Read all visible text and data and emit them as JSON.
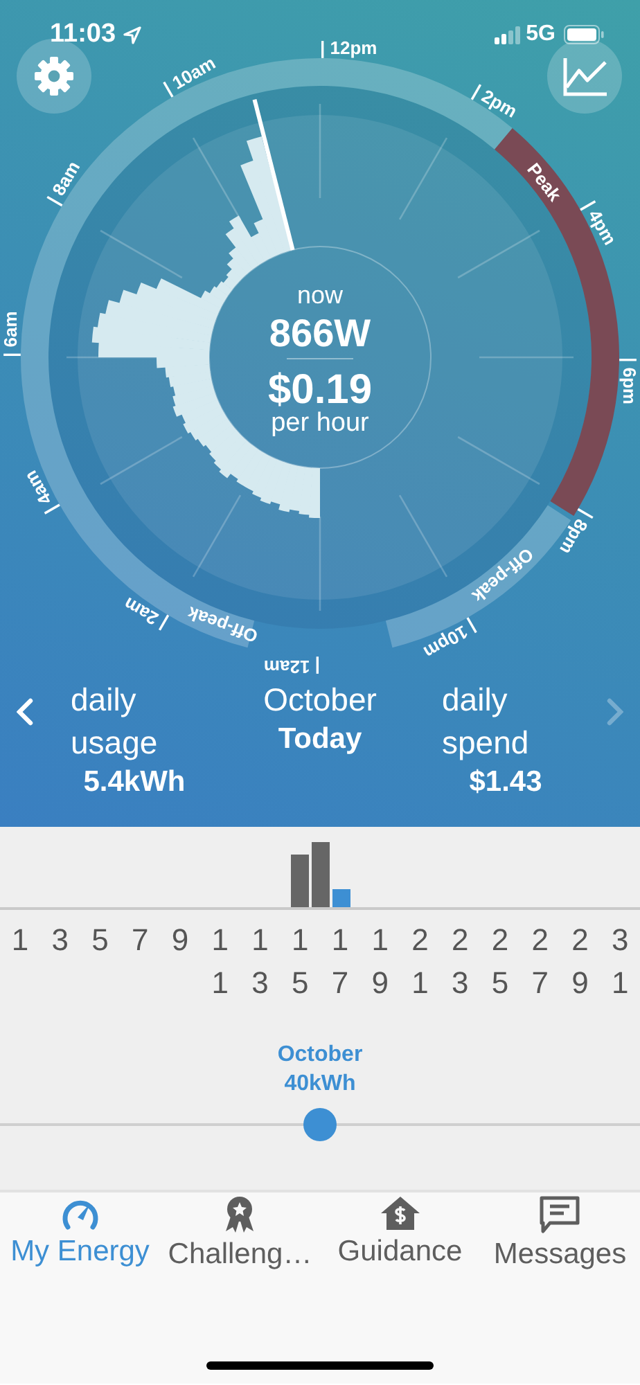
{
  "status_bar": {
    "time": "11:03",
    "network": "5G"
  },
  "dial": {
    "now_label": "now",
    "power": "866W",
    "cost": "$0.19",
    "cost_unit": "per hour",
    "hour_labels": [
      "| 12pm",
      "| 2pm",
      "| 4pm",
      "| 6pm",
      "| 8pm",
      "| 10pm",
      "| 12am",
      "| 2am",
      "| 4am",
      "| 6am",
      "| 8am",
      "| 10am"
    ],
    "tariff_segments": [
      {
        "label": "Peak",
        "kind": "peak"
      },
      {
        "label": "Off-peak",
        "kind": "off-peak"
      },
      {
        "label": "Off-peak",
        "kind": "off-peak"
      }
    ]
  },
  "summary": {
    "previous": {
      "disabled": false
    },
    "next": {
      "disabled": true
    },
    "usage_label": "daily usage",
    "usage_value": "5.4kWh",
    "month": "October",
    "day": "Today",
    "spend_label": "daily spend",
    "spend_value": "$1.43"
  },
  "daily_chart": {
    "day_labels": [
      "1",
      "3",
      "5",
      "7",
      "9",
      "11",
      "13",
      "15",
      "17",
      "19",
      "21",
      "23",
      "25",
      "27",
      "29",
      "31"
    ]
  },
  "month_slider": {
    "month": "October",
    "total": "40kWh",
    "level": 0.5
  },
  "tab_bar": [
    {
      "label": "My Energy",
      "selected": true
    },
    {
      "label": "Challeng…",
      "selected": false
    },
    {
      "label": "Guidance",
      "selected": false
    },
    {
      "label": "Messages",
      "selected": false
    }
  ]
}
